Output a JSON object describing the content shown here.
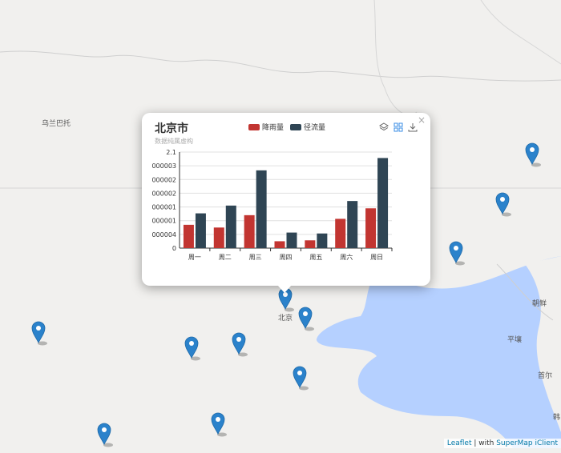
{
  "map": {
    "labels": [
      {
        "id": "ulanbator",
        "text": "乌兰巴托"
      },
      {
        "id": "beijing",
        "text": "北京"
      },
      {
        "id": "korea",
        "text": "朝鲜"
      },
      {
        "id": "pyongyang",
        "text": "平壤"
      },
      {
        "id": "seoul",
        "text": "首尔"
      },
      {
        "id": "south-korea",
        "text": "韩"
      }
    ],
    "marker_color": "#2b82cb",
    "sea_color": "#b5d0ff"
  },
  "popup": {
    "title": "北京市",
    "subtitle": "数据纯属虚构",
    "close_label": "×",
    "legend": [
      {
        "name": "降雨量",
        "color": "#c23531"
      },
      {
        "name": "径流量",
        "color": "#2f4554"
      }
    ],
    "tools": [
      "layers-icon",
      "grid-icon",
      "download-icon"
    ]
  },
  "chart_data": {
    "type": "bar",
    "categories": [
      "周一",
      "周二",
      "周三",
      "周四",
      "周五",
      "周六",
      "周日"
    ],
    "y_tick_labels": [
      "0",
      "000004",
      "000001",
      "000001",
      "000002",
      "000002",
      "000003",
      "2.1"
    ],
    "series": [
      {
        "name": "降雨量",
        "color": "#c23531",
        "values": [
          0.51,
          0.45,
          0.72,
          0.15,
          0.17,
          0.64,
          0.87
        ]
      },
      {
        "name": "径流量",
        "color": "#2f4554",
        "values": [
          0.76,
          0.93,
          1.7,
          0.34,
          0.32,
          1.03,
          1.97
        ]
      }
    ],
    "ylim": [
      0,
      2.1
    ]
  },
  "attribution": {
    "leaflet": "Leaflet",
    "sep": " | with ",
    "supermap": "SuperMap iClient"
  }
}
